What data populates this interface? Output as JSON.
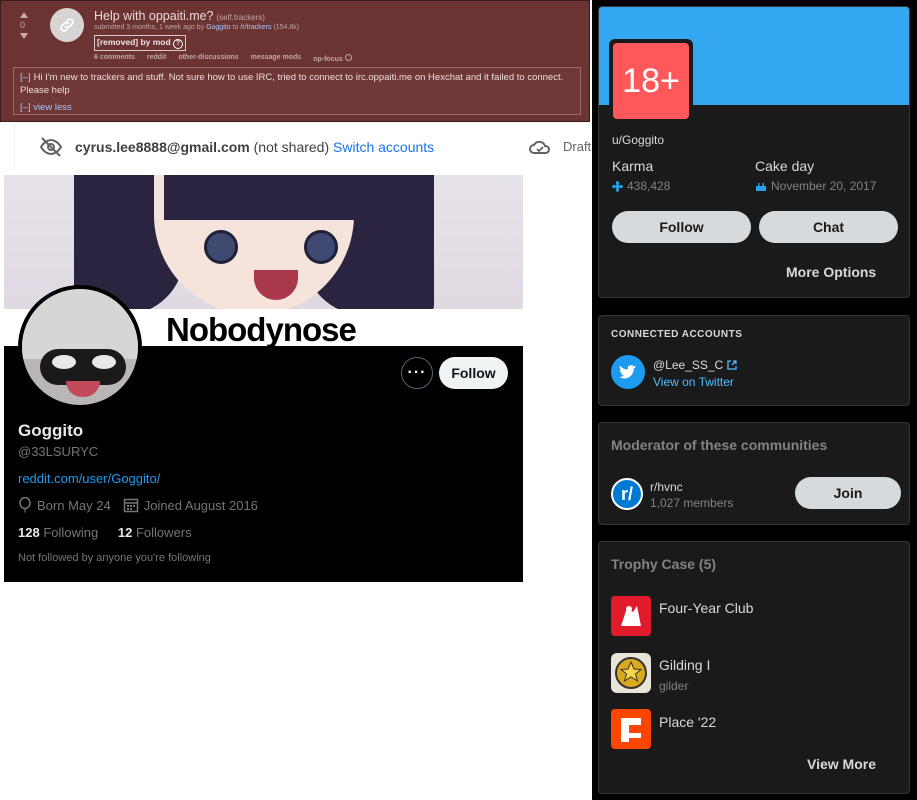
{
  "post": {
    "score": "0",
    "title": "Help with oppaiti.me?",
    "domain": "(self.trackers)",
    "submitted_prefix": "submitted 3 months, 1 week ago by",
    "author": "Goggito",
    "to": "to",
    "subreddit": "/r/trackers",
    "subscribers": "(154.8k)",
    "removed_tag": "[removed] by mod",
    "links": [
      "6 comments",
      "reddit",
      "other-discussions",
      "message mods",
      "op-focus"
    ],
    "body_toggle": "[–]",
    "body": "Hi I'm new to trackers and stuff. Not sure how to use IRC, tried to connect to irc.oppaiti.me on Hexchat and it failed to connect. Please help",
    "view_less": "[–] view less"
  },
  "account": {
    "email": "cyrus.lee8888@gmail.com",
    "not_shared": "(not shared)",
    "switch": "Switch accounts",
    "draft": "Draft"
  },
  "twitter": {
    "banner_text": "Nobodynose",
    "follow_label": "Follow",
    "name": "Goggito",
    "handle": "@33LSURYC",
    "url": "reddit.com/user/Goggito/",
    "born": "Born May 24",
    "joined": "Joined August 2016",
    "following_count": "128",
    "following_label": "Following",
    "followers_count": "12",
    "followers_label": "Followers",
    "not_followed": "Not followed by anyone you're following"
  },
  "reddit_profile": {
    "nsfw_badge": "18+",
    "username": "u/Goggito",
    "karma_label": "Karma",
    "karma_value": "438,428",
    "cakeday_label": "Cake day",
    "cakeday_value": "November 20, 2017",
    "follow_label": "Follow",
    "chat_label": "Chat",
    "more_options": "More Options"
  },
  "connected": {
    "section_label": "CONNECTED ACCOUNTS",
    "handle": "@Lee_SS_C",
    "link": "View on Twitter"
  },
  "moderator": {
    "title": "Moderator of these communities",
    "community": "r/hvnc",
    "members": "1,027 members",
    "join_label": "Join"
  },
  "trophies": {
    "title": "Trophy Case (5)",
    "items": [
      {
        "name": "Four-Year Club",
        "sub": ""
      },
      {
        "name": "Gilding I",
        "sub": "gilder"
      },
      {
        "name": "Place '22",
        "sub": ""
      }
    ],
    "view_more": "View More"
  },
  "colors": {
    "post_bg": "#6b3432",
    "twitter_blue": "#1d9bf0",
    "reddit_cover": "#33a8f0",
    "nsfw_red": "#ff585b",
    "sidebar_card": "#1a1a1b"
  }
}
